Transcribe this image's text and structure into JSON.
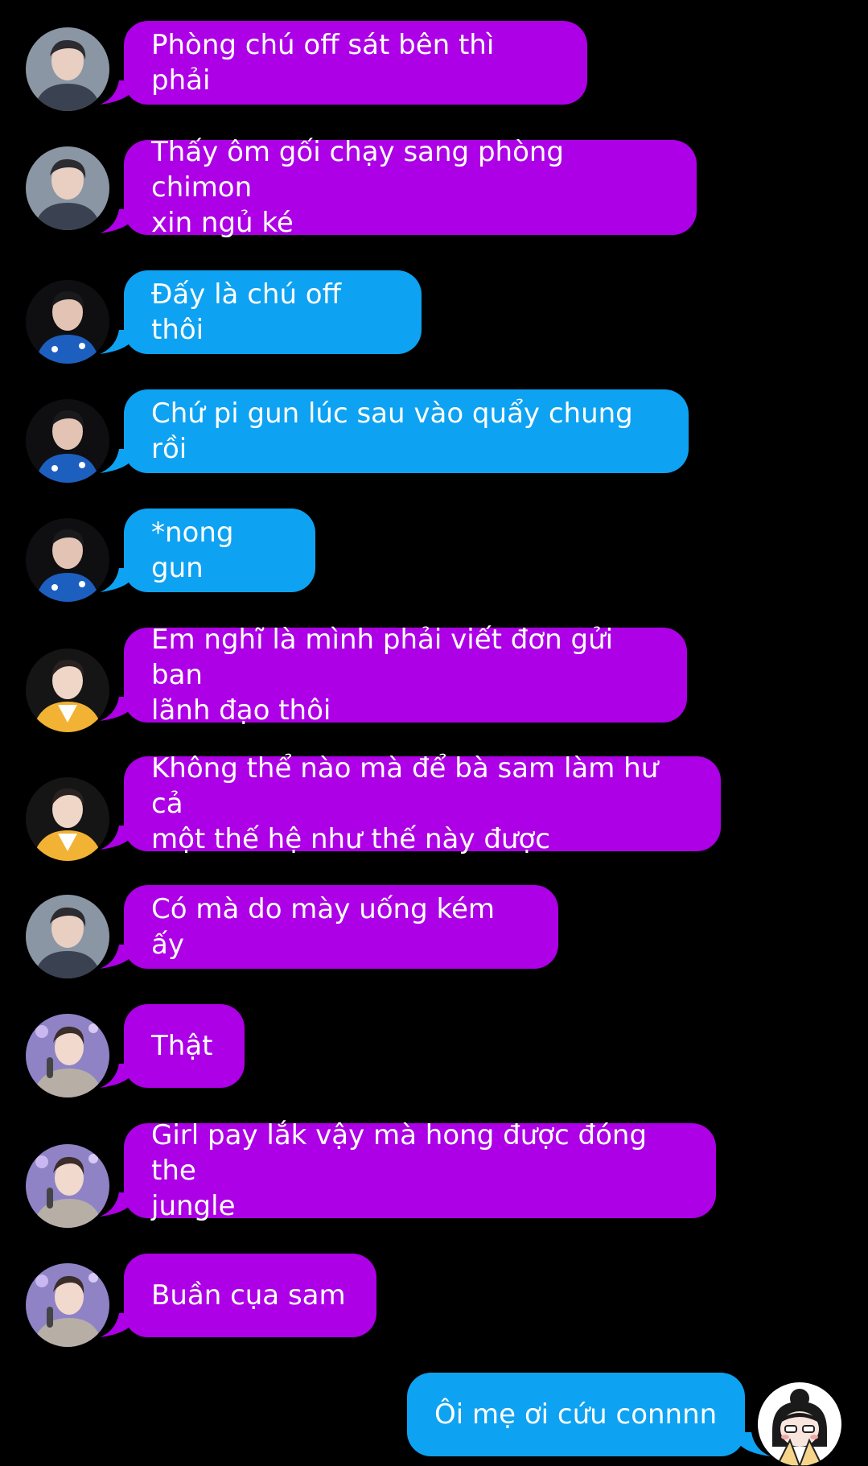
{
  "colors": {
    "background": "#000000",
    "purple_bubble": "#ad00e6",
    "blue_bubble": "#0ea2f2",
    "text": "#ffffff"
  },
  "messages": [
    {
      "sender": "avatar-a",
      "color": "purple",
      "text": "Phòng chú off sát bên thì phải"
    },
    {
      "sender": "avatar-a",
      "color": "purple",
      "text": "Thấy ôm gối chạy sang phòng chimon\nxin ngủ ké"
    },
    {
      "sender": "avatar-b",
      "color": "blue",
      "text": "Đấy là chú off thôi"
    },
    {
      "sender": "avatar-b",
      "color": "blue",
      "text": "Chứ pi gun lúc sau vào quẩy chung rồi"
    },
    {
      "sender": "avatar-b",
      "color": "blue",
      "text": "*nong gun"
    },
    {
      "sender": "avatar-c",
      "color": "purple",
      "text": "Em nghĩ là mình phải viết đơn gửi ban\nlãnh đạo thôi"
    },
    {
      "sender": "avatar-c",
      "color": "purple",
      "text": "Không thể nào mà để bà sam làm hư cả\nmột thế hệ như thế này được"
    },
    {
      "sender": "avatar-a",
      "color": "purple",
      "text": "Có mà do mày uống kém ấy"
    },
    {
      "sender": "avatar-d",
      "color": "purple",
      "text": "Thật"
    },
    {
      "sender": "avatar-d",
      "color": "purple",
      "text": "Girl pay lắk vậy mà hong được đóng the\njungle"
    },
    {
      "sender": "avatar-d",
      "color": "purple",
      "text": "Buần cụa sam"
    },
    {
      "sender": "self",
      "color": "blue",
      "text": "Ôi mẹ ơi cứu connnn"
    }
  ]
}
